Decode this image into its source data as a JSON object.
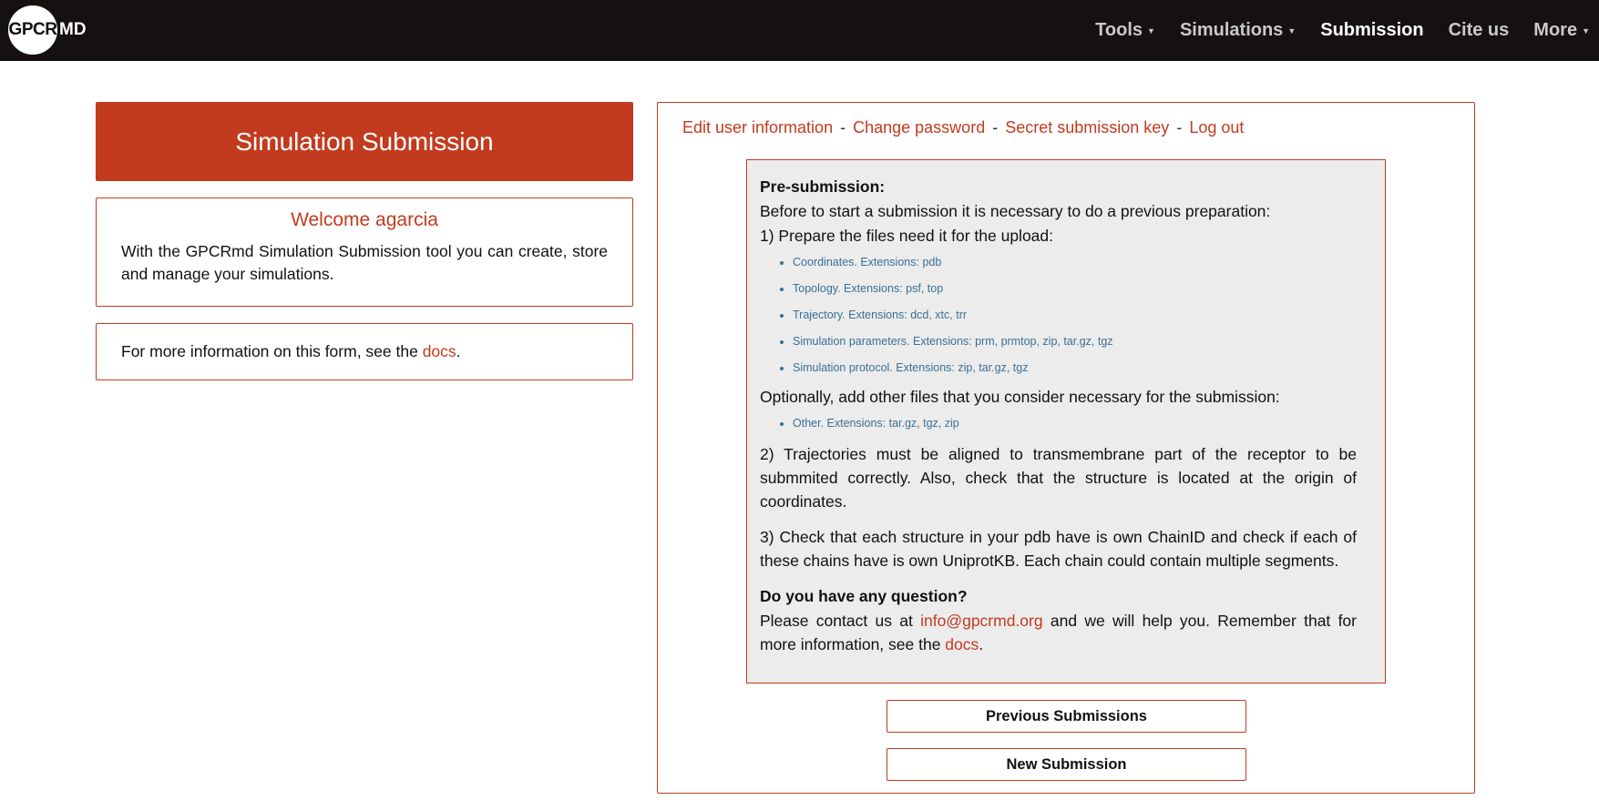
{
  "nav": {
    "logo_circle": "GPCR",
    "logo_suffix": "MD",
    "items": [
      {
        "label": "Tools",
        "caret": "▼"
      },
      {
        "label": "Simulations",
        "caret": "▼"
      },
      {
        "label": "Submission"
      },
      {
        "label": "Cite us"
      },
      {
        "label": "More",
        "caret": "▼"
      }
    ]
  },
  "left": {
    "banner_title": "Simulation Submission",
    "welcome_title": "Welcome agarcia",
    "welcome_text": "With the GPCRmd Simulation Submission tool you can create, store and manage your simulations.",
    "info_prefix": "For more information on this form, see the ",
    "info_link": "docs",
    "info_suffix": "."
  },
  "right": {
    "user_links": [
      "Edit user information",
      "Change password",
      "Secret submission key",
      "Log out"
    ],
    "separator": "-",
    "pre_heading": "Pre-submission:",
    "intro": "Before to start a submission it is necessary to do a previous preparation:",
    "step1": "1) Prepare the files need it for the upload:",
    "files": [
      "Coordinates. Extensions: pdb",
      "Topology. Extensions: psf, top",
      "Trajectory. Extensions: dcd, xtc, trr",
      "Simulation parameters. Extensions: prm, prmtop, zip, tar.gz, tgz",
      "Simulation protocol. Extensions: zip, tar.gz, tgz"
    ],
    "optional_text": "Optionally, add other files that you consider necessary for the submission:",
    "optional_files": [
      "Other. Extensions: tar.gz, tgz, zip"
    ],
    "step2": "2) Trajectories must be aligned to transmembrane part of the receptor to be submmited correctly. Also, check that the structure is located at the origin of coordinates.",
    "step3": "3) Check that each structure in your pdb have is own ChainID and check if each of these chains have is own UniprotKB. Each chain could contain multiple segments.",
    "question_heading": "Do you have any question?",
    "contact_prefix": "Please contact us at ",
    "contact_email": "info@gpcrmd.org",
    "contact_middle": " and we will help you. Remember that for more information, see the ",
    "contact_docs": "docs",
    "contact_suffix": ".",
    "previous_button": "Previous Submissions",
    "new_button": "New Submission"
  },
  "colors": {
    "accent": "#c23b1f",
    "navbar": "#161111",
    "panel_bg": "#ececec",
    "list_text": "#3a6f95"
  }
}
